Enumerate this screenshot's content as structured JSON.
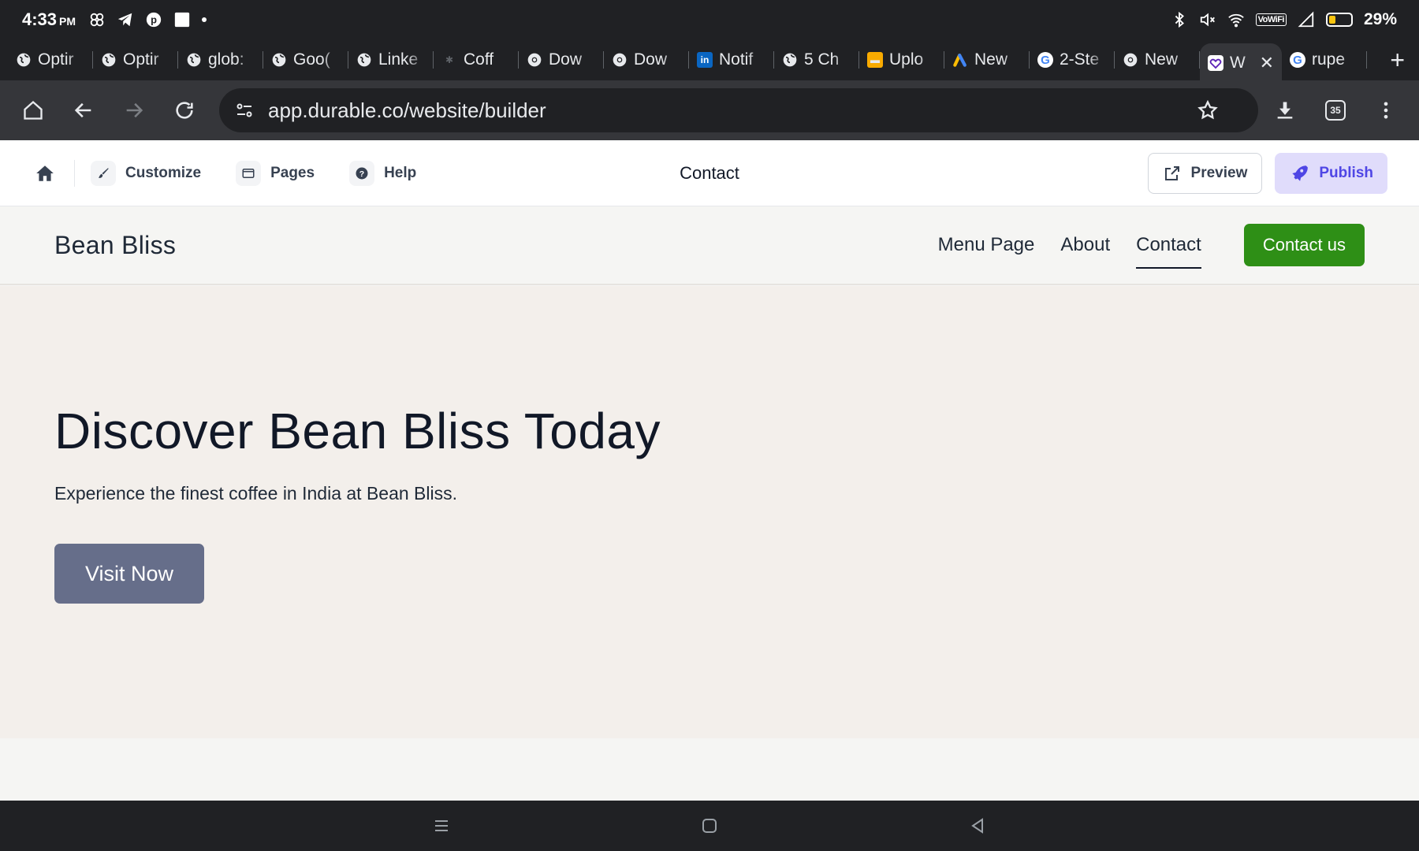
{
  "status_bar": {
    "time": "4:33",
    "ampm": "PM",
    "battery": "29%",
    "wifi_label": "VoWiFi"
  },
  "tabs": [
    {
      "label": "Optir",
      "icon": "globe-icon"
    },
    {
      "label": "Optir",
      "icon": "globe-icon"
    },
    {
      "label": "glob:",
      "icon": "globe-icon"
    },
    {
      "label": "Goo(",
      "icon": "globe-icon"
    },
    {
      "label": "Linke",
      "icon": "globe-icon"
    },
    {
      "label": "Coff",
      "icon": "coffee-icon"
    },
    {
      "label": "Dow",
      "icon": "chrome-icon"
    },
    {
      "label": "Dow",
      "icon": "chrome-icon"
    },
    {
      "label": "Notif",
      "icon": "linkedin-icon"
    },
    {
      "label": "5 Ch",
      "icon": "globe-icon"
    },
    {
      "label": "Uplo",
      "icon": "upload-icon"
    },
    {
      "label": "New",
      "icon": "google-ads-icon"
    },
    {
      "label": "2-Ste",
      "icon": "google-icon"
    },
    {
      "label": "New",
      "icon": "chrome-icon"
    },
    {
      "label": "W",
      "icon": "durable-icon",
      "active": true
    },
    {
      "label": "rupe",
      "icon": "google-icon"
    }
  ],
  "address_bar": {
    "url": "app.durable.co/website/builder",
    "tab_count": "35"
  },
  "builder": {
    "customize": "Customize",
    "pages": "Pages",
    "help": "Help",
    "current_page": "Contact",
    "preview": "Preview",
    "publish": "Publish"
  },
  "site": {
    "brand": "Bean Bliss",
    "nav": [
      "Menu Page",
      "About",
      "Contact"
    ],
    "active_nav": "Contact",
    "cta": "Contact us",
    "hero_title": "Discover Bean Bliss Today",
    "hero_subtitle": "Experience the finest coffee in India at Bean Bliss.",
    "hero_button": "Visit Now"
  },
  "colors": {
    "cta_green": "#2e8f16",
    "hero_button": "#666e8a",
    "hero_bg": "#f3efeb",
    "publish_bg": "#e0dcfb",
    "publish_text": "#4f46e5"
  }
}
